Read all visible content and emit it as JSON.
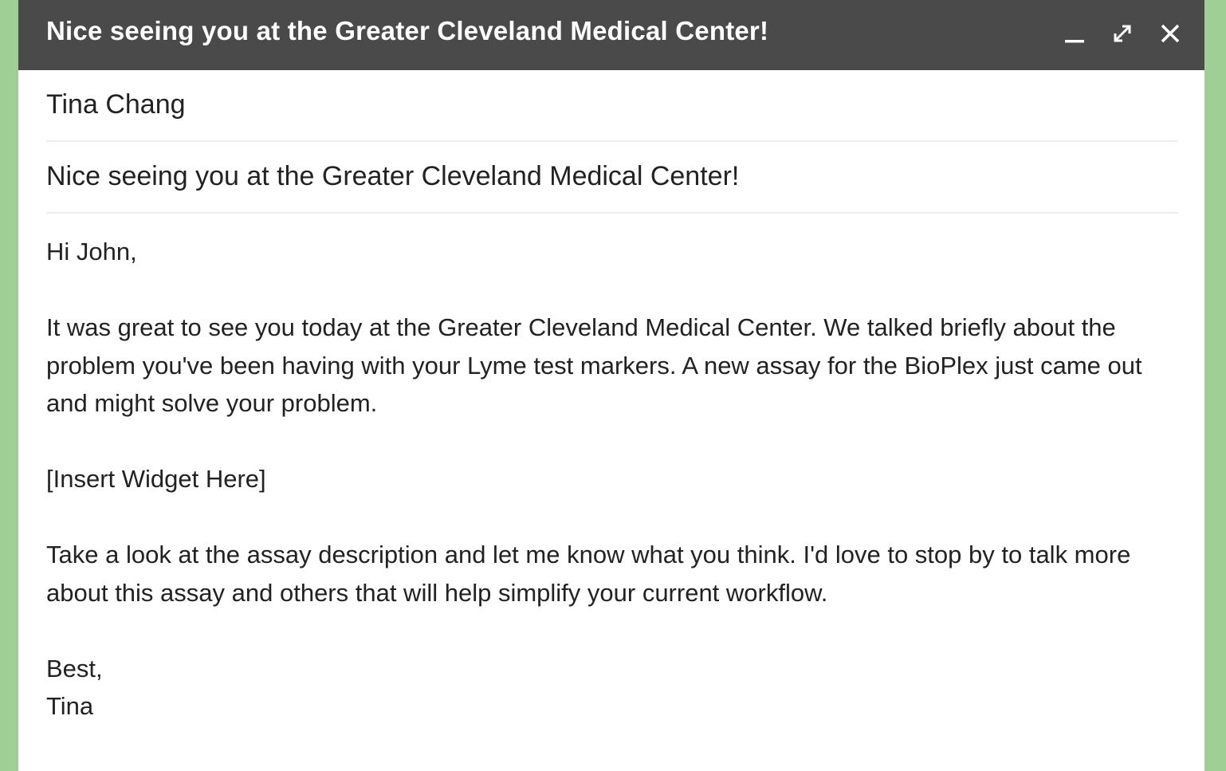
{
  "window": {
    "title": "Nice seeing you at the Greater Cleveland Medical Center!",
    "controls": {
      "minimize_icon": "minimize-icon",
      "expand_icon": "expand-icon",
      "close_icon": "close-icon"
    }
  },
  "compose": {
    "to": "Tina Chang",
    "subject": "Nice seeing you at the Greater Cleveland Medical Center!",
    "body": {
      "greeting": "Hi John,",
      "paragraph1": "It was great to see you today at the Greater Cleveland Medical Center. We talked briefly about the problem you've been having with your Lyme test markers. A new assay for the BioPlex just came out and might solve your problem.",
      "placeholder": "[Insert Widget Here]",
      "paragraph2": "Take a look at the assay description and let me know what you think. I'd love to stop by to talk more about this assay and others that will help simplify your current workflow.",
      "signoff": "Best,",
      "signature": "Tina"
    }
  },
  "colors": {
    "titlebar": "#4a4a4a",
    "background": "#9fcf94",
    "text": "#222222"
  }
}
